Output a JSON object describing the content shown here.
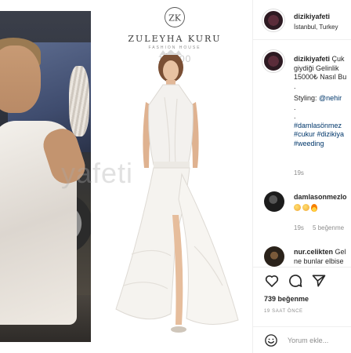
{
  "post": {
    "username": "dizikiyafeti",
    "location": "İstanbul, Turkey"
  },
  "media": {
    "brand_name": "ZULEYHA KURU",
    "brand_sub": "FASHION HOUSE",
    "price": "15.000",
    "watermark": "yafeti"
  },
  "caption": {
    "username": "dizikiyafeti",
    "line1": "Çuk",
    "line2": "giydiği Gelinlik",
    "line3": "15000₺ Nasıl Bu",
    "line4": ".",
    "line5_prefix": "Styling: ",
    "line5_link": "@nehir",
    "line6": ".",
    "line7": ".",
    "tags": [
      "#damlasönmez",
      "#cukur #dizikiya",
      "#weeding"
    ],
    "time": "19s"
  },
  "comments": [
    {
      "username": "damlasonmezlo",
      "text": "",
      "time": "19s",
      "likes": "5 beğenme"
    },
    {
      "username": "nur.celikten",
      "text": "Gel",
      "text2": "ne bunlar elbise"
    }
  ],
  "actions": {
    "like_label": "like",
    "comment_label": "comment",
    "share_label": "share"
  },
  "likes_text": "739 beğenme",
  "time_ago": "19 SAAT ÖNCE",
  "add_comment_placeholder": "Yorum ekle..."
}
